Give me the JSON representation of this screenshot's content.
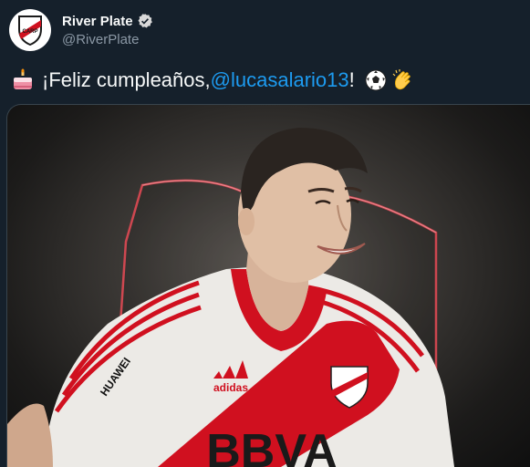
{
  "account": {
    "display_name": "River Plate",
    "handle": "@RiverPlate",
    "verified": true,
    "avatar_icon": "river-plate-crest-icon"
  },
  "tweet": {
    "text_before": "¡Feliz cumpleaños, ",
    "mention": "@lucasalario13",
    "text_after": "! ",
    "leading_emoji": "birthday-cake-emoji",
    "trailing_emojis": [
      "soccer-ball-emoji",
      "clapping-hands-emoji"
    ]
  },
  "media": {
    "jersey_sponsor": "BBVA",
    "jersey_brand": "adidas",
    "sleeve_sponsor": "HUAWEI",
    "crest_letters": "CARP"
  },
  "colors": {
    "background": "#15202b",
    "mention": "#1d9bf0",
    "club_red": "#d0101f",
    "verified": "#d9d9d9"
  }
}
